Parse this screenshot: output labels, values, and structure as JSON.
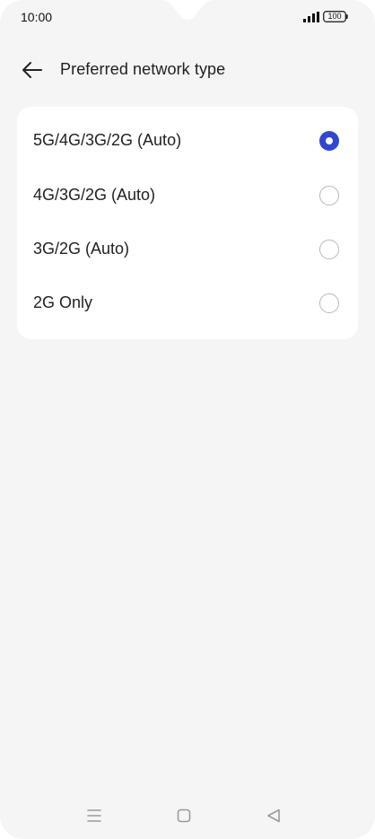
{
  "status_bar": {
    "time": "10:00",
    "battery": "100"
  },
  "header": {
    "title": "Preferred network type",
    "back_icon": "arrow-left-icon"
  },
  "options": [
    {
      "label": "5G/4G/3G/2G (Auto)",
      "selected": true
    },
    {
      "label": "4G/3G/2G (Auto)",
      "selected": false
    },
    {
      "label": "3G/2G (Auto)",
      "selected": false
    },
    {
      "label": "2G Only",
      "selected": false
    }
  ],
  "nav_bar": {
    "menu_icon": "menu-icon",
    "home_icon": "home-icon",
    "back_icon": "back-triangle-icon"
  },
  "colors": {
    "accent": "#2f47d4",
    "background": "#f5f5f5",
    "card": "#ffffff"
  }
}
